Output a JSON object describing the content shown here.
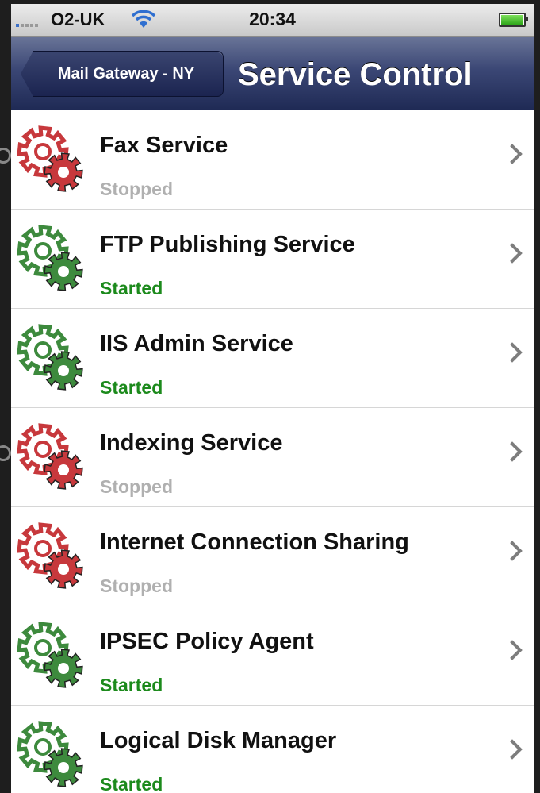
{
  "status_bar": {
    "carrier": "O2-UK",
    "time": "20:34"
  },
  "nav": {
    "back_label": "Mail Gateway - NY",
    "title": "Service Control"
  },
  "colors": {
    "started": "#1c8a1c",
    "stopped": "#b0b0b0",
    "gear_started": "#3d8a3d",
    "gear_stopped": "#c7383c"
  },
  "services": [
    {
      "name": "Fax Service",
      "status": "Stopped",
      "state": "stopped"
    },
    {
      "name": "FTP Publishing Service",
      "status": "Started",
      "state": "started"
    },
    {
      "name": "IIS Admin Service",
      "status": "Started",
      "state": "started"
    },
    {
      "name": "Indexing Service",
      "status": "Stopped",
      "state": "stopped"
    },
    {
      "name": "Internet Connection Sharing",
      "status": "Stopped",
      "state": "stopped"
    },
    {
      "name": "IPSEC Policy Agent",
      "status": "Started",
      "state": "started"
    },
    {
      "name": "Logical Disk Manager",
      "status": "Started",
      "state": "started"
    }
  ]
}
